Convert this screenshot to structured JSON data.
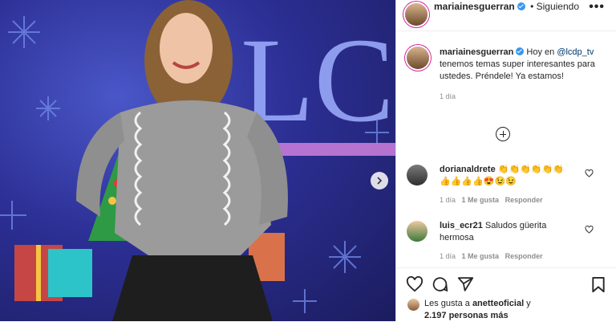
{
  "post": {
    "username": "mariainesguerran",
    "follow_status": "Siguiendo",
    "more_label": "•••",
    "caption_text_before": "Hoy en ",
    "caption_mention": "@lcdp_tv",
    "caption_text_after": " tenemos temas super interesantes para ustedes. Préndele! Ya estamos!",
    "caption_time": "1 día",
    "photo_sign_text": "LC"
  },
  "comments": [
    {
      "username": "dorianaldrete",
      "text": "👏👏👏👏👏👏 👍👍👍👍😍😉😉",
      "time": "1 día",
      "likes": "1 Me gusta",
      "reply": "Responder"
    },
    {
      "username": "luis_ecr21",
      "text": "Saludos güerita hermosa",
      "time": "1 día",
      "likes": "1 Me gusta",
      "reply": "Responder"
    }
  ],
  "likes": {
    "prefix": "Les gusta a ",
    "user": "anetteoficial",
    "suffix": " y",
    "count": "2.197 personas más"
  },
  "icons": [
    "heart-icon",
    "comment-icon",
    "share-icon",
    "bookmark-icon",
    "add-comment-icon",
    "chevron-right-icon",
    "verified-icon"
  ],
  "colors": {
    "verified": "#3897f0",
    "mention": "#00376b",
    "meta": "#8e8e8e",
    "story_ring": "#d6249f"
  }
}
